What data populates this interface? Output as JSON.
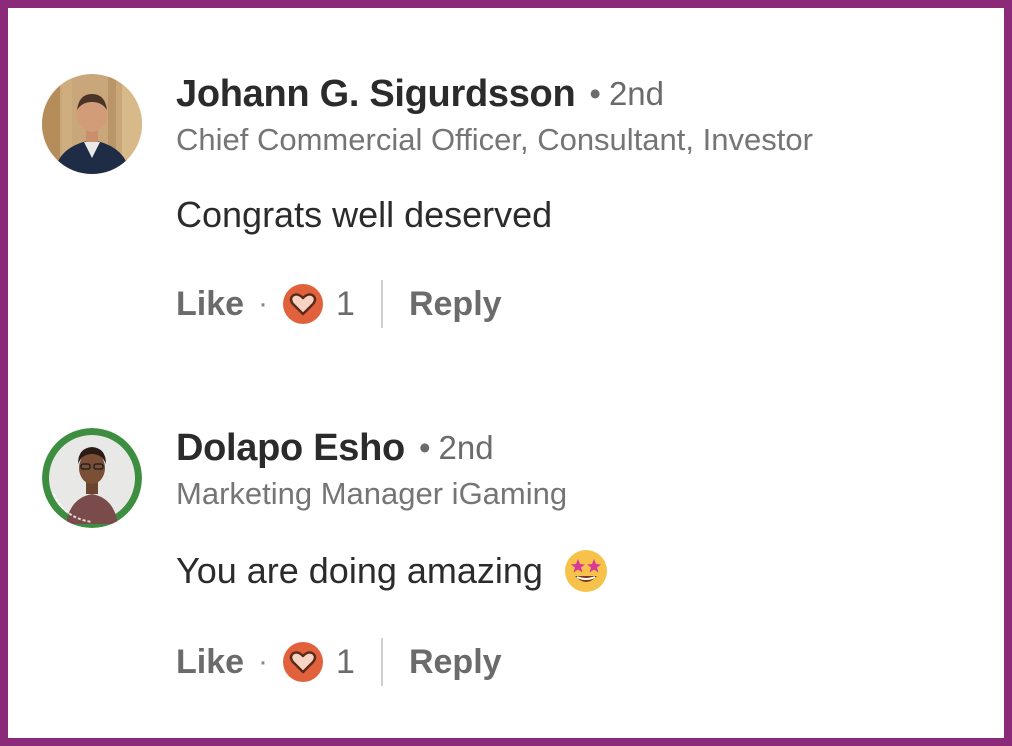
{
  "comments": [
    {
      "name": "Johann G. Sigurdsson",
      "degree": "2nd",
      "headline": "Chief Commercial Officer, Consultant, Investor",
      "text": "Congrats well deserved",
      "emoji": "",
      "like_label": "Like",
      "reaction_icon": "heart-icon",
      "reaction_count": "1",
      "reply_label": "Reply"
    },
    {
      "name": "Dolapo Esho",
      "degree": "2nd",
      "headline": "Marketing Manager iGaming",
      "text": "You are doing amazing",
      "emoji": "star-struck-emoji-icon",
      "like_label": "Like",
      "reaction_icon": "heart-icon",
      "reaction_count": "1",
      "reply_label": "Reply"
    }
  ],
  "colors": {
    "frame_border": "#8c2a7a",
    "reaction_heart": "#e0613c",
    "open_to_work_ring": "#3e8e41"
  }
}
